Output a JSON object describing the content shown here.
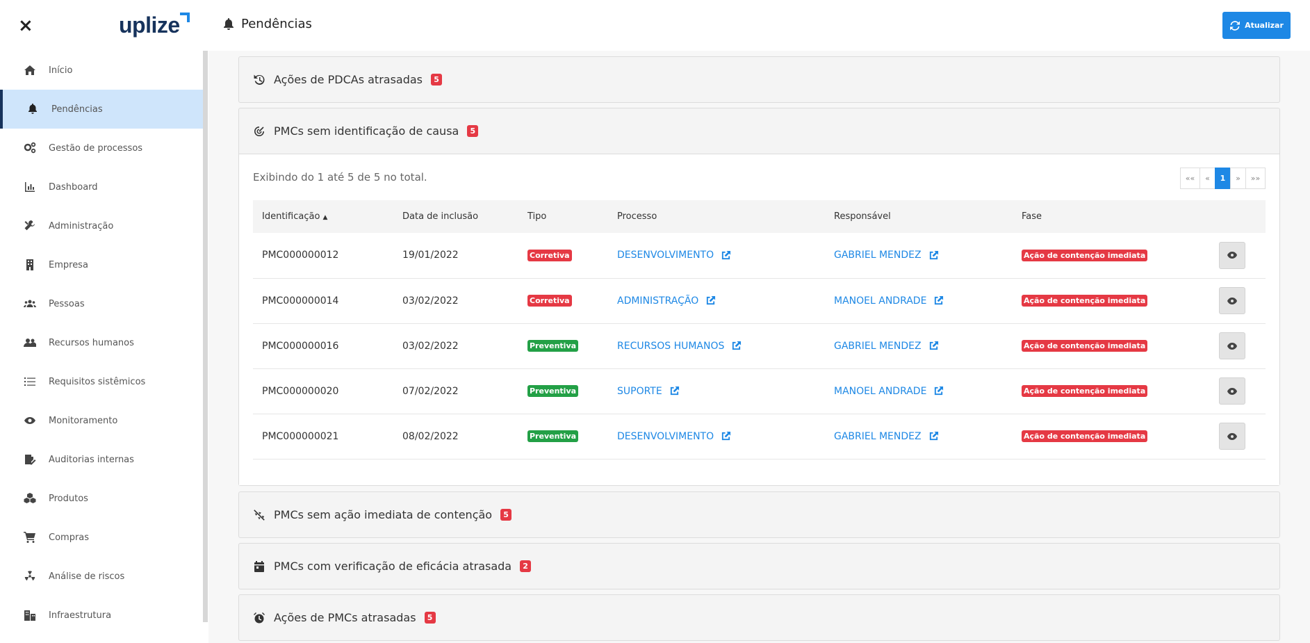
{
  "topbar": {
    "logo_text": "uplize",
    "page_title": "Pendências",
    "refresh_label": "Atualizar"
  },
  "sidebar": {
    "items": [
      {
        "label": "Início",
        "icon": "home-icon"
      },
      {
        "label": "Pendências",
        "icon": "bell-icon",
        "active": true
      },
      {
        "label": "Gestão de processos",
        "icon": "gears-icon"
      },
      {
        "label": "Dashboard",
        "icon": "chart-icon"
      },
      {
        "label": "Administração",
        "icon": "tools-icon"
      },
      {
        "label": "Empresa",
        "icon": "building-icon"
      },
      {
        "label": "Pessoas",
        "icon": "people-icon"
      },
      {
        "label": "Recursos humanos",
        "icon": "user-friends-icon"
      },
      {
        "label": "Requisitos sistêmicos",
        "icon": "list-icon"
      },
      {
        "label": "Monitoramento",
        "icon": "eye-icon"
      },
      {
        "label": "Auditorias internas",
        "icon": "audit-icon"
      },
      {
        "label": "Produtos",
        "icon": "cubes-icon"
      },
      {
        "label": "Compras",
        "icon": "cart-icon"
      },
      {
        "label": "Análise de riscos",
        "icon": "radiation-icon"
      },
      {
        "label": "Infraestrutura",
        "icon": "city-icon"
      }
    ]
  },
  "panels": {
    "p1": {
      "title": "Ações de PDCAs atrasadas",
      "count": "5"
    },
    "p2": {
      "title": "PMCs sem identificação de causa",
      "count": "5"
    },
    "p3": {
      "title": "PMCs sem ação imediata de contenção",
      "count": "5"
    },
    "p4": {
      "title": "PMCs com verificação de eficácia atrasada",
      "count": "2"
    },
    "p5": {
      "title": "Ações de PMCs atrasadas",
      "count": "5"
    }
  },
  "table": {
    "info": "Exibindo do 1 até 5 de 5 no total.",
    "pager": {
      "first": "««",
      "prev": "«",
      "current": "1",
      "next": "»",
      "last": "»»"
    },
    "headers": {
      "id": "Identificação",
      "date": "Data de inclusão",
      "type": "Tipo",
      "process": "Processo",
      "owner": "Responsável",
      "phase": "Fase"
    },
    "rows": [
      {
        "id": "PMC000000012",
        "date": "19/01/2022",
        "type": "Corretiva",
        "process": "DESENVOLVIMENTO",
        "owner": "GABRIEL  MENDEZ",
        "phase": "Ação de contenção imediata"
      },
      {
        "id": "PMC000000014",
        "date": "03/02/2022",
        "type": "Corretiva",
        "process": "ADMINISTRAÇÃO",
        "owner": "MANOEL ANDRADE",
        "phase": "Ação de contenção imediata"
      },
      {
        "id": "PMC000000016",
        "date": "03/02/2022",
        "type": "Preventiva",
        "process": "RECURSOS  HUMANOS",
        "owner": "GABRIEL  MENDEZ",
        "phase": "Ação de contenção imediata"
      },
      {
        "id": "PMC000000020",
        "date": "07/02/2022",
        "type": "Preventiva",
        "process": "SUPORTE",
        "owner": "MANOEL ANDRADE",
        "phase": "Ação de contenção imediata"
      },
      {
        "id": "PMC000000021",
        "date": "08/02/2022",
        "type": "Preventiva",
        "process": "DESENVOLVIMENTO",
        "owner": "GABRIEL  MENDEZ",
        "phase": "Ação de contenção imediata"
      }
    ]
  },
  "colors": {
    "accent": "#1e88e5",
    "danger": "#e53944",
    "success": "#23a046",
    "brand": "#17335c",
    "active_bg": "#cfe5fb"
  }
}
